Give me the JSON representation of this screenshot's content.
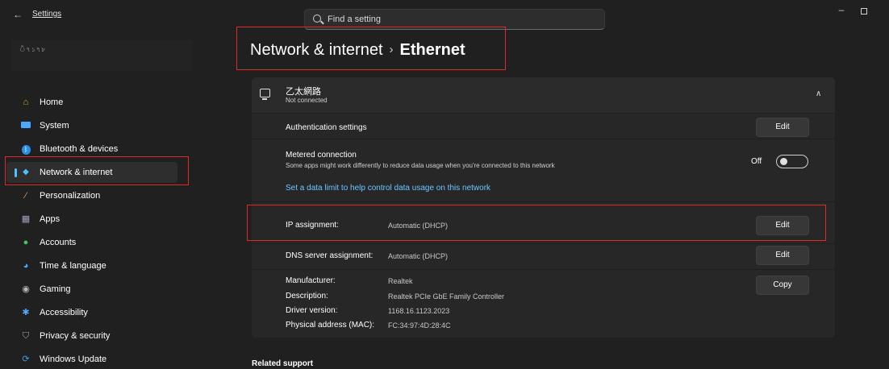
{
  "app": {
    "title": "Settings",
    "user_name": "ঁ৭১৭৮"
  },
  "search": {
    "placeholder": "Find a setting"
  },
  "sidebar": {
    "items": [
      {
        "label": "Home",
        "icon": "home-icon",
        "color": "#f0a030"
      },
      {
        "label": "System",
        "icon": "monitor-icon",
        "color": "#4aa8ff"
      },
      {
        "label": "Bluetooth & devices",
        "icon": "bluetooth-icon",
        "color": "#2b8fe8"
      },
      {
        "label": "Network & internet",
        "icon": "wifi-icon",
        "color": "#4cc2ff",
        "active": true
      },
      {
        "label": "Personalization",
        "icon": "brush-icon",
        "color": "#e8a060"
      },
      {
        "label": "Apps",
        "icon": "apps-icon",
        "color": "#9aa5b5"
      },
      {
        "label": "Accounts",
        "icon": "person-icon",
        "color": "#3ec26e"
      },
      {
        "label": "Time & language",
        "icon": "clock-globe-icon",
        "color": "#4aa8ff"
      },
      {
        "label": "Gaming",
        "icon": "gamepad-icon",
        "color": "#b8b8b8"
      },
      {
        "label": "Accessibility",
        "icon": "accessibility-icon",
        "color": "#4aa8ff"
      },
      {
        "label": "Privacy & security",
        "icon": "shield-icon",
        "color": "#9aa5b5"
      },
      {
        "label": "Windows Update",
        "icon": "update-icon",
        "color": "#3aa0e8"
      }
    ]
  },
  "breadcrumb": {
    "parent": "Network & internet",
    "separator": "›",
    "current": "Ethernet"
  },
  "adapter": {
    "name": "乙太網路",
    "status": "Not connected"
  },
  "auth": {
    "label": "Authentication settings",
    "button": "Edit"
  },
  "metered": {
    "label": "Metered connection",
    "description": "Some apps might work differently to reduce data usage when you're connected to this network",
    "toggle_state": "Off",
    "link": "Set a data limit to help control data usage on this network"
  },
  "ip": {
    "label": "IP assignment:",
    "value": "Automatic (DHCP)",
    "button": "Edit"
  },
  "dns": {
    "label": "DNS server assignment:",
    "value": "Automatic (DHCP)",
    "button": "Edit"
  },
  "properties": {
    "rows": [
      {
        "label": "Manufacturer:",
        "value": "Realtek"
      },
      {
        "label": "Description:",
        "value": "Realtek PCIe GbE Family Controller"
      },
      {
        "label": "Driver version:",
        "value": "1168.16.1123.2023"
      },
      {
        "label": "Physical address (MAC):",
        "value": "FC:34:97:4D:28:4C"
      }
    ],
    "button": "Copy"
  },
  "related": {
    "title": "Related support"
  },
  "colors": {
    "accent": "#4cc2ff",
    "link": "#6cc6ff",
    "highlight": "#e02a2a"
  }
}
